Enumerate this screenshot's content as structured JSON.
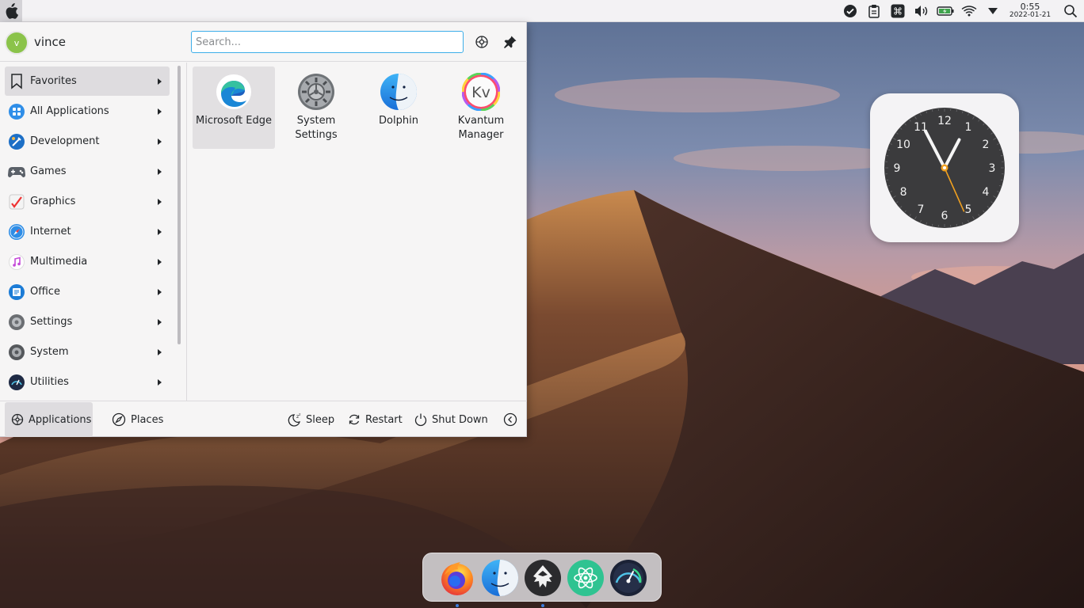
{
  "desktop": {
    "wallpaper": "desert-dunes-dusk"
  },
  "topbar": {
    "apple_icon": "apple-logo-icon",
    "tray_icons": [
      "check-circle-icon",
      "clipboard-icon",
      "command-key-icon",
      "volume-icon",
      "battery-icon",
      "wifi-icon",
      "tray-expand-arrow-icon"
    ],
    "time": "0:55",
    "date": "2022-01-21"
  },
  "launcher": {
    "user": {
      "initial": "v",
      "name": "vince"
    },
    "search": {
      "placeholder": "Search...",
      "value": ""
    },
    "categories": [
      {
        "label": "Favorites",
        "icon": "bookmark-icon",
        "active": true
      },
      {
        "label": "All Applications",
        "icon": "grid-apps-icon"
      },
      {
        "label": "Development",
        "icon": "development-icon"
      },
      {
        "label": "Games",
        "icon": "gamepad-icon"
      },
      {
        "label": "Graphics",
        "icon": "graphics-icon"
      },
      {
        "label": "Internet",
        "icon": "compass-icon"
      },
      {
        "label": "Multimedia",
        "icon": "music-note-icon"
      },
      {
        "label": "Office",
        "icon": "office-icon"
      },
      {
        "label": "Settings",
        "icon": "settings-gear-icon"
      },
      {
        "label": "System",
        "icon": "system-gear-icon"
      },
      {
        "label": "Utilities",
        "icon": "gauge-icon"
      }
    ],
    "apps": [
      {
        "label": "Microsoft Edge",
        "icon": "edge-icon",
        "active": true
      },
      {
        "label": "System\nSettings",
        "icon": "system-settings-icon"
      },
      {
        "label": "Dolphin",
        "icon": "dolphin-finder-icon"
      },
      {
        "label": "Kvantum\nManager",
        "icon": "kvantum-icon",
        "icon_text": "Kv"
      }
    ],
    "footer": {
      "applications": "Applications",
      "places": "Places",
      "sleep": "Sleep",
      "restart": "Restart",
      "shutdown": "Shut Down"
    }
  },
  "clock_widget": {
    "numerals": [
      "12",
      "1",
      "2",
      "3",
      "4",
      "5",
      "6",
      "7",
      "8",
      "9",
      "10",
      "11"
    ],
    "hour": 0,
    "minute": 55,
    "second": 26
  },
  "dock": {
    "items": [
      {
        "name": "firefox",
        "icon": "firefox-icon",
        "running": true
      },
      {
        "name": "finder",
        "icon": "finder-icon",
        "running": false
      },
      {
        "name": "inkscape",
        "icon": "inkscape-icon",
        "running": true
      },
      {
        "name": "atom",
        "icon": "atom-icon",
        "running": false
      },
      {
        "name": "system-monitor",
        "icon": "gauge-dial-icon",
        "running": false
      }
    ]
  }
}
